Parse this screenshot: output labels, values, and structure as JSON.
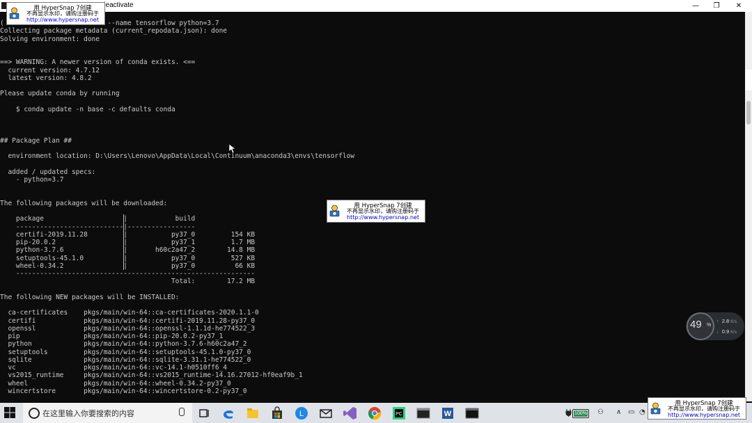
{
  "window": {
    "title_visible": "deactivate",
    "controls": {
      "minimize": "—",
      "maximize": "❐",
      "close": "✕"
    }
  },
  "console": {
    "lines": [
      "(                 a create --name tensorflow python=3.7",
      "Collecting package metadata (current_repodata.json): done",
      "Solving environment: done",
      "",
      "",
      "==> WARNING: A newer version of conda exists. <==",
      "  current version: 4.7.12",
      "  latest version: 4.8.2",
      "",
      "Please update conda by running",
      "",
      "    $ conda update -n base -c defaults conda",
      "",
      "",
      "",
      "## Package Plan ##",
      "",
      "  environment location: D:\\Users\\Lenovo\\AppData\\Local\\Continuum\\anaconda3\\envs\\tensorflow",
      "",
      "  added / updated specs:",
      "    - python=3.7",
      "",
      "",
      "The following packages will be downloaded:",
      "",
      "    package                    |            build",
      "    ---------------------------|-----------------",
      "    certifi-2019.11.28         |           py37_0         154 KB",
      "    pip-20.0.2                 |           py37_1         1.7 MB",
      "    python-3.7.6               |       h60c2a47_2        14.8 MB",
      "    setuptools-45.1.0          |           py37_0         527 KB",
      "    wheel-0.34.2               |           py37_0          66 KB",
      "    ------------------------------------------------------------",
      "                                           Total:        17.2 MB",
      "",
      "The following NEW packages will be INSTALLED:",
      "",
      "  ca-certificates    pkgs/main/win-64::ca-certificates-2020.1.1-0",
      "  certifi            pkgs/main/win-64::certifi-2019.11.28-py37_0",
      "  openssl            pkgs/main/win-64::openssl-1.1.1d-he774522_3",
      "  pip                pkgs/main/win-64::pip-20.0.2-py37_1",
      "  python             pkgs/main/win-64::python-3.7.6-h60c2a47_2",
      "  setuptools         pkgs/main/win-64::setuptools-45.1.0-py37_0",
      "  sqlite             pkgs/main/win-64::sqlite-3.31.1-he774522_0",
      "  vc                 pkgs/main/win-64::vc-14.1-h0510ff6_4",
      "  vs2015_runtime     pkgs/main/win-64::vs2015_runtime-14.16.27012-hf0eaf9b_1",
      "  wheel              pkgs/main/win-64::wheel-0.34.2-py37_0",
      "  wincertstore       pkgs/main/win-64::wincertstore-0.2-py37_0"
    ]
  },
  "watermark": {
    "line1": "用 HyperSnap 7创建",
    "line2": "不再显示水印，请购注册码于",
    "line3": "http://www.hypersnap.net"
  },
  "net_widget": {
    "percent": "49",
    "percent_sign": "%",
    "upload": "2.8",
    "download": "0.9",
    "unit": "K/s"
  },
  "taskbar": {
    "search_placeholder": "在这里输入你要搜索的内容",
    "battery": "100%"
  },
  "colors": {
    "console_bg": "#0c0c0c",
    "console_text": "#cccccc",
    "taskbar_bg": "#dfe3e8"
  }
}
